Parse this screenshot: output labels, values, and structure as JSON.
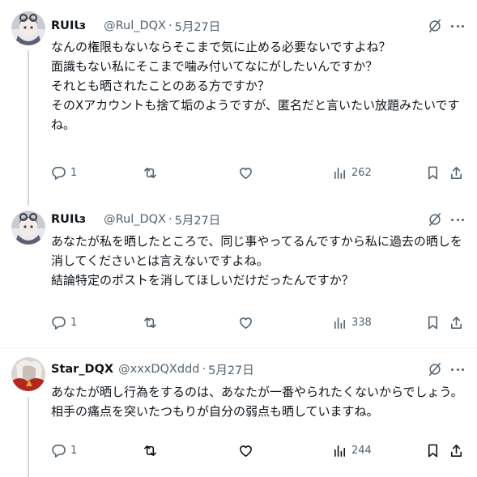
{
  "tweets": [
    {
      "name": "RUIƖз",
      "handle": "@Rul_DQX",
      "date": "5月27日",
      "lines": [
        "なんの権限もないならそこまで気に止める必要ないですよね？",
        "面識もない私にそこまで噛み付いてなにがしたいんですか？",
        "それとも晒されたことのある方ですか？",
        "そのXアカウントも捨て垢のようですが、匿名だと言いたい放題みたいです",
        "ね。"
      ],
      "replies": "1",
      "retweets": "",
      "likes": "",
      "views": "262"
    },
    {
      "name": "RUIƖз",
      "handle": "@Rul_DQX",
      "date": "5月27日",
      "lines": [
        "あなたが私を晒したところで、同じ事やってるんですから私に過去の晒しを",
        "消してくださいとは言えないですよね。",
        "結論特定のポストを消してほしいだけだったんですか？"
      ],
      "replies": "1",
      "retweets": "",
      "likes": "",
      "views": "338"
    },
    {
      "name": "Star_DQX",
      "handle": "@xxxDQXddd",
      "date": "5月27日",
      "lines": [
        "あなたが晒し行為をするのは、あなたが一番やられたくないからでしょう。",
        "相手の痛点を突いたつもりが自分の弱点も晒していますね。"
      ],
      "replies": "1",
      "retweets": "",
      "likes": "",
      "views": "244"
    }
  ],
  "separator": "·",
  "icons": {
    "reply": "reply-icon",
    "retweet": "retweet-icon",
    "like": "heart-icon",
    "views": "views-icon",
    "bookmark": "bookmark-icon",
    "share": "share-icon",
    "grok": "grok-icon",
    "more": "more-icon"
  },
  "colors": {
    "text": "#0f1419",
    "secondary": "#536471",
    "thread_line": "#cfd9de",
    "divider": "#eff3f4"
  }
}
